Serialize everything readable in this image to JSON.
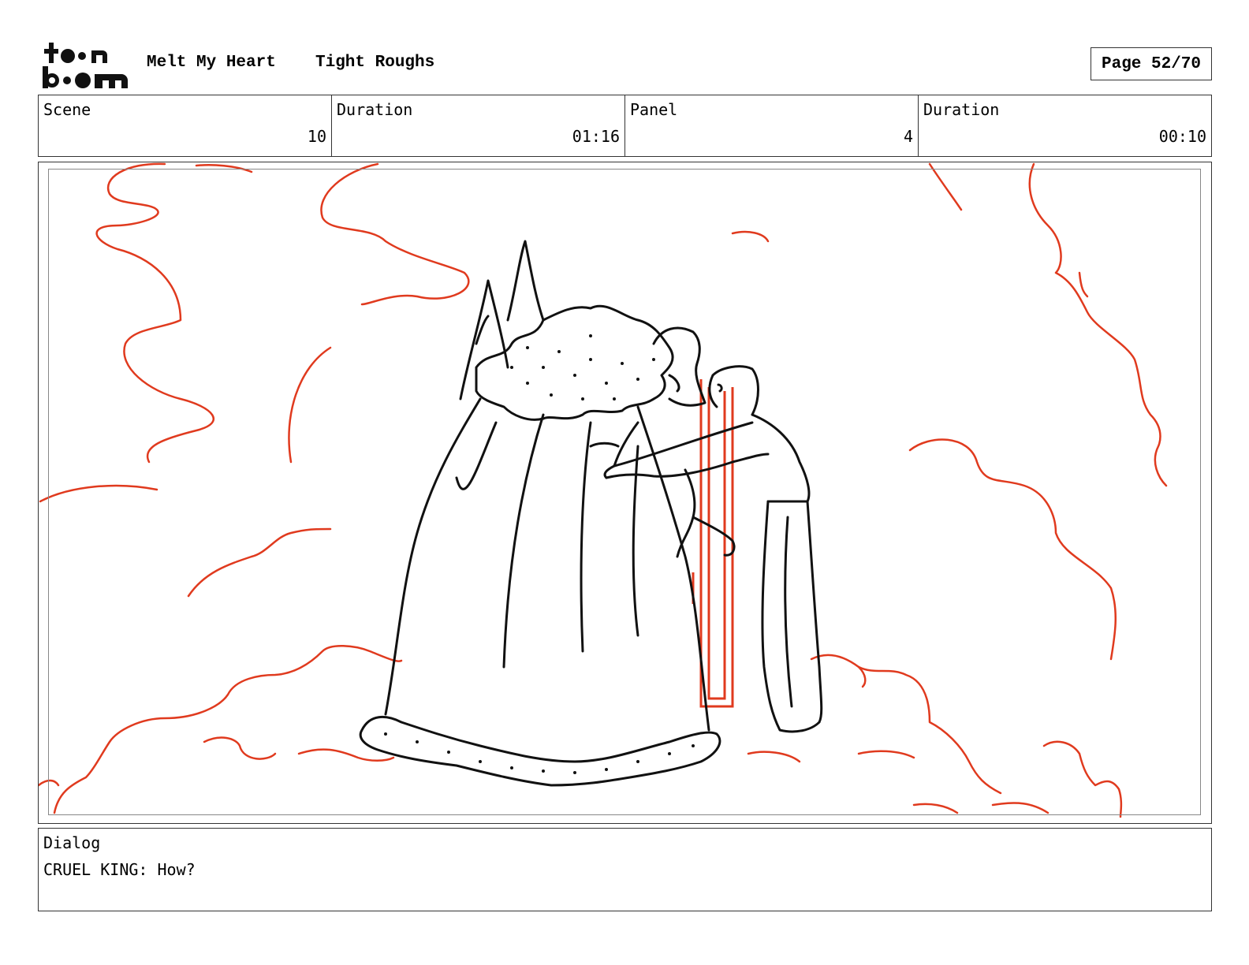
{
  "header": {
    "logo_text": "toon boom",
    "project_title": "Melt My Heart",
    "section_title": "Tight Roughs",
    "page_label": "Page 52/70"
  },
  "info": {
    "scene_label": "Scene",
    "scene_value": "10",
    "scene_duration_label": "Duration",
    "scene_duration_value": "01:16",
    "panel_label": "Panel",
    "panel_value": "4",
    "panel_duration_label": "Duration",
    "panel_duration_value": "00:10"
  },
  "dialog": {
    "label": "Dialog",
    "text": "CRUEL KING: How?"
  },
  "colors": {
    "sketch_red": "#e03a1e",
    "ink": "#111111",
    "border": "#333333"
  }
}
